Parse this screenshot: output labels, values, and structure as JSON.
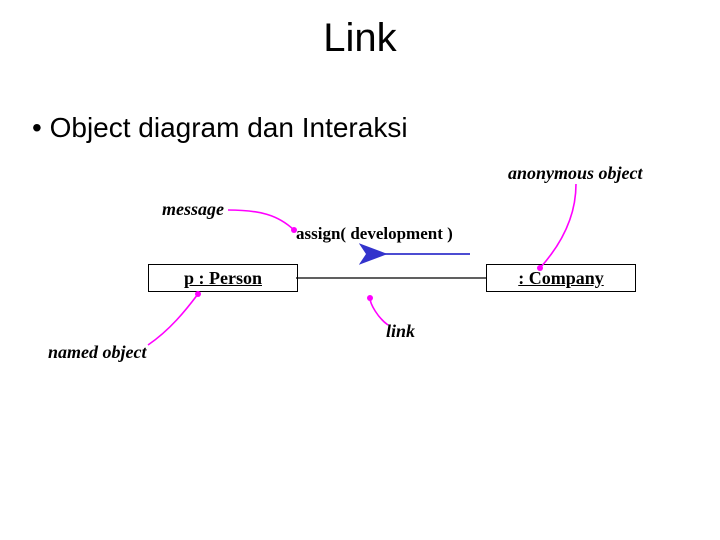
{
  "title": "Link",
  "bullet": "Object diagram dan Interaksi",
  "annotations": {
    "anonymous_object": "anonymous object",
    "message": "message",
    "named_object": "named object",
    "link": "link"
  },
  "message_label": "assign( development )",
  "objects": {
    "person": "p : Person",
    "company": ": Company"
  },
  "colors": {
    "pointer": "#ff00ff",
    "arrow": "#3333cc"
  }
}
